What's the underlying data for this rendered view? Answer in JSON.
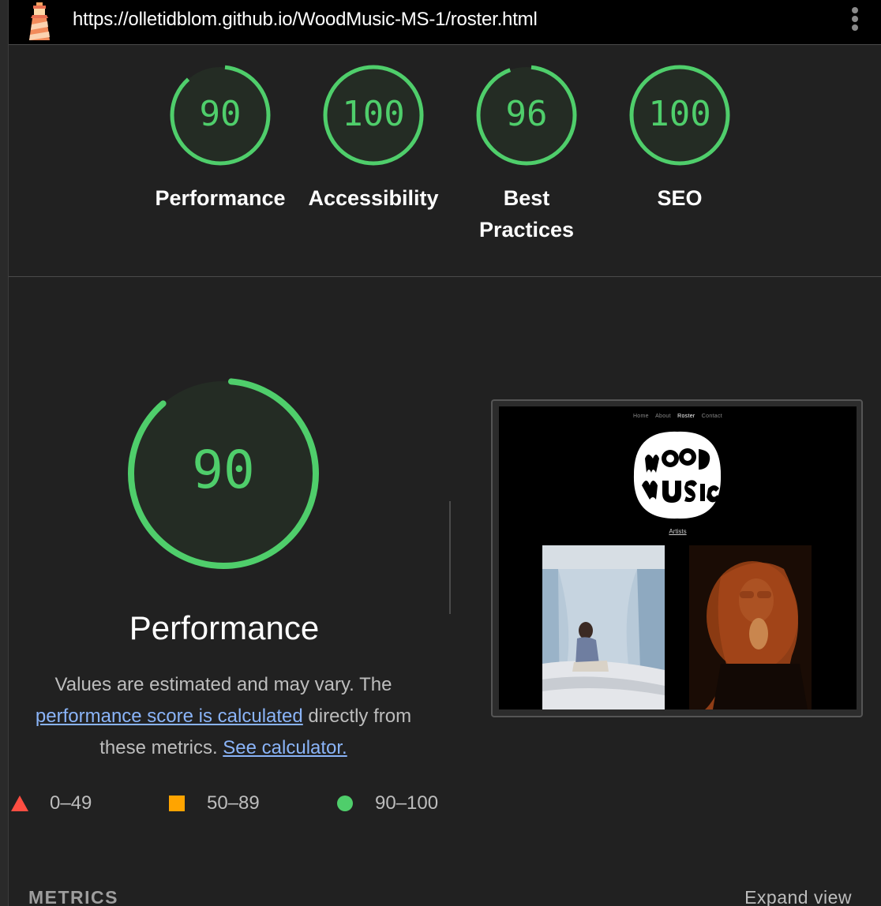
{
  "url": "https://olletidblom.github.io/WoodMusic-MS-1/roster.html",
  "colors": {
    "pass": "#4fce6b",
    "average": "#ffa400",
    "fail": "#ff4e42",
    "link": "#8ab4f8"
  },
  "gauges": [
    {
      "score": "90",
      "value": 0.9,
      "label": "Performance"
    },
    {
      "score": "100",
      "value": 1.0,
      "label": "Accessibility"
    },
    {
      "score": "96",
      "value": 0.96,
      "label": "Best Practices",
      "label_line1": "Best",
      "label_line2": "Practices"
    },
    {
      "score": "100",
      "value": 1.0,
      "label": "SEO"
    }
  ],
  "performance": {
    "score": "90",
    "value": 0.9,
    "title": "Performance",
    "desc_prefix": "Values are estimated and may vary. The ",
    "desc_link1": "performance score is calculated",
    "desc_middle": " directly from these metrics. ",
    "desc_link2": "See calculator."
  },
  "legend": [
    {
      "icon": "triangle-icon",
      "range": "0–49"
    },
    {
      "icon": "square-icon",
      "range": "50–89"
    },
    {
      "icon": "circle-icon",
      "range": "90–100"
    }
  ],
  "screenshot": {
    "nav": [
      "Home",
      "About",
      "Roster",
      "Contact"
    ],
    "active_nav": "Roster",
    "logo_text": "WOOD MUSIC",
    "artists_link": "Artists"
  },
  "metrics": {
    "heading": "METRICS",
    "expand_label": "Expand view"
  }
}
